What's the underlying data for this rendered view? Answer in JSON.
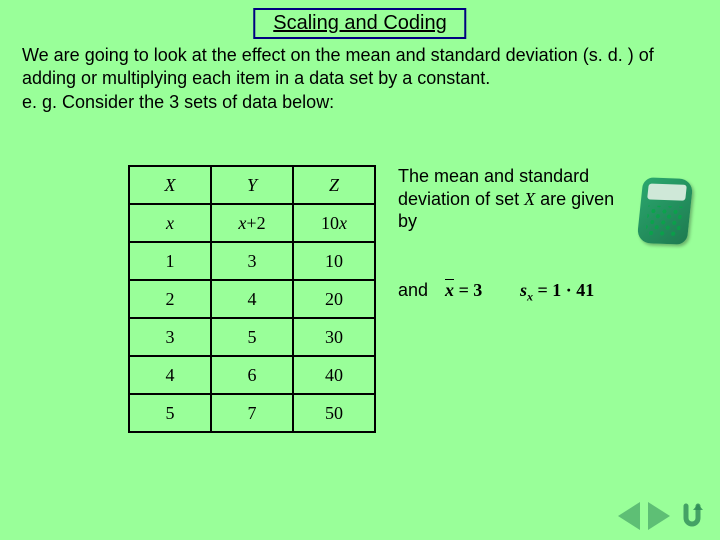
{
  "title": "Scaling and Coding",
  "intro": "We are going to look at the effect on the mean and standard deviation (s. d. ) of adding or multiplying each item in a data set by a constant.\ne. g. Consider the 3 sets of data below:",
  "table": {
    "headers": {
      "c0": "X",
      "c1": "Y",
      "c2": "Z"
    },
    "formulas": {
      "c0": "x",
      "c1_prefix": "x",
      "c1_suffix": "+2",
      "c2_prefix": "10",
      "c2_suffix": "x"
    },
    "rows": [
      {
        "c0": "1",
        "c1": "3",
        "c2": "10"
      },
      {
        "c0": "2",
        "c1": "4",
        "c2": "20"
      },
      {
        "c0": "3",
        "c1": "5",
        "c2": "30"
      },
      {
        "c0": "4",
        "c1": "6",
        "c2": "40"
      },
      {
        "c0": "5",
        "c1": "7",
        "c2": "50"
      }
    ]
  },
  "side_text_1_a": "The mean and standard deviation of set ",
  "side_text_1_set": "X",
  "side_text_1_b": " are given by",
  "and_label": "and",
  "formula_mean": {
    "lhs_bar": "x",
    "eq": " = ",
    "rhs": "3"
  },
  "formula_sd": {
    "s": "s",
    "sub": "x",
    "eq": " = ",
    "rhs": "1 · 41"
  },
  "nav": {
    "prev": "◀",
    "next": "▶",
    "back": "↩"
  }
}
